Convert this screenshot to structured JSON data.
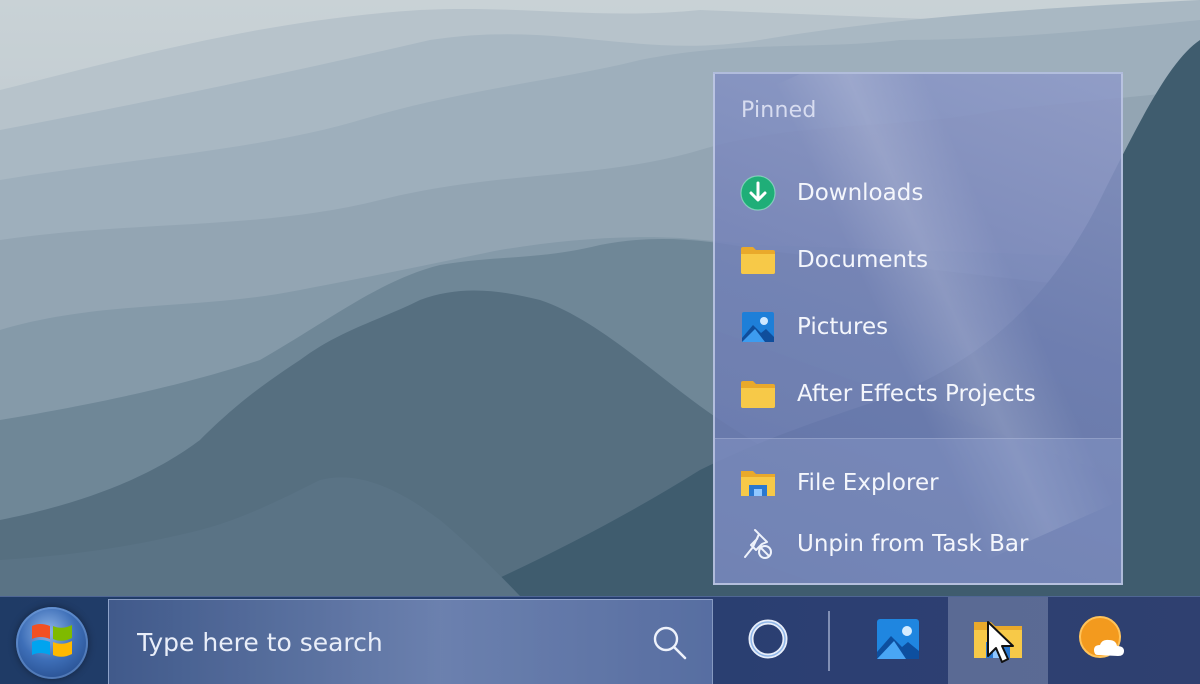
{
  "jumplist": {
    "heading": "Pinned",
    "pinned": [
      {
        "label": "Downloads",
        "icon": "download-icon"
      },
      {
        "label": "Documents",
        "icon": "folder-icon"
      },
      {
        "label": "Pictures",
        "icon": "pictures-icon"
      },
      {
        "label": "After Effects Projects",
        "icon": "folder-icon"
      }
    ],
    "tasks": [
      {
        "label": "File Explorer",
        "icon": "file-explorer-icon"
      },
      {
        "label": "Unpin from Task Bar",
        "icon": "unpin-icon"
      }
    ]
  },
  "taskbar": {
    "search_placeholder": "Type here to search",
    "apps": [
      {
        "name": "photos-app-icon"
      },
      {
        "name": "file-explorer-app-icon",
        "active": true
      },
      {
        "name": "weather-app-icon"
      }
    ]
  },
  "colors": {
    "taskbar": "#263f6f",
    "jumplist": "#7684ba",
    "folder": "#f5c242",
    "download": "#21b07a"
  }
}
